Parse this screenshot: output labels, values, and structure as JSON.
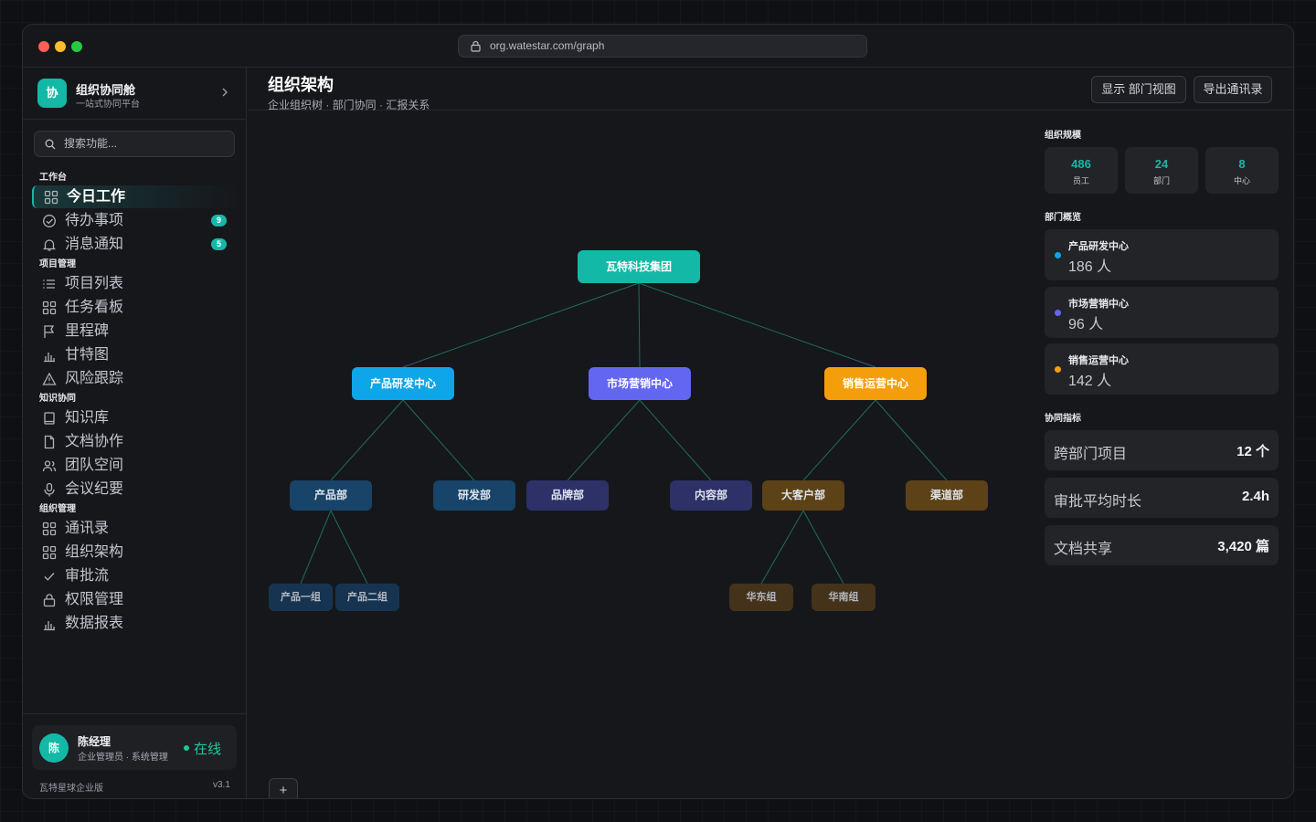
{
  "browser": {
    "url": "org.watestar.com/graph"
  },
  "brand": {
    "name": "组织协同舱",
    "subtitle": "一站式协同平台",
    "logo_text": "协"
  },
  "search": {
    "placeholder": "搜索功能..."
  },
  "sidebar": {
    "sections": [
      {
        "title": "工作台",
        "items": [
          {
            "label": "今日工作",
            "icon": "grid-icon",
            "active": true
          },
          {
            "label": "待办事项",
            "icon": "check-circle-icon",
            "badge": "9"
          },
          {
            "label": "消息通知",
            "icon": "bell-icon",
            "badge": "5"
          }
        ]
      },
      {
        "title": "项目管理",
        "items": [
          {
            "label": "项目列表",
            "icon": "list-icon"
          },
          {
            "label": "任务看板",
            "icon": "grid-icon"
          },
          {
            "label": "里程碑",
            "icon": "flag-icon"
          },
          {
            "label": "甘特图",
            "icon": "bar-chart-icon"
          },
          {
            "label": "风险跟踪",
            "icon": "warning-icon"
          }
        ]
      },
      {
        "title": "知识协同",
        "items": [
          {
            "label": "知识库",
            "icon": "book-icon"
          },
          {
            "label": "文档协作",
            "icon": "file-icon"
          },
          {
            "label": "团队空间",
            "icon": "users-icon"
          },
          {
            "label": "会议纪要",
            "icon": "mic-icon"
          }
        ]
      },
      {
        "title": "组织管理",
        "items": [
          {
            "label": "通讯录",
            "icon": "grid-icon"
          },
          {
            "label": "组织架构",
            "icon": "grid-icon"
          },
          {
            "label": "审批流",
            "icon": "check-icon"
          },
          {
            "label": "权限管理",
            "icon": "lock-icon"
          },
          {
            "label": "数据报表",
            "icon": "bar-chart-icon"
          }
        ]
      }
    ]
  },
  "user": {
    "avatar": "陈",
    "name": "陈经理",
    "role": "企业管理员 · 系统管理",
    "status": "在线"
  },
  "footer": {
    "edition": "瓦特星球企业版",
    "version": "v3.1"
  },
  "header": {
    "title": "组织架构",
    "subtitle": "企业组织树 · 部门协同 · 汇报关系",
    "btn_view": "显示 部门视图",
    "btn_export": "导出通讯录"
  },
  "org": {
    "root": "瓦特科技集团",
    "centers": [
      "产品研发中心",
      "市场营销中心",
      "销售运营中心"
    ],
    "departments": [
      "产品部",
      "研发部",
      "品牌部",
      "内容部",
      "大客户部",
      "渠道部"
    ],
    "groups": [
      "产品一组",
      "产品二组",
      "华东组",
      "华南组"
    ]
  },
  "canvas": {
    "add_label": "+"
  },
  "right": {
    "scale_title": "组织规模",
    "stats": [
      {
        "value": "486",
        "label": "员工"
      },
      {
        "value": "24",
        "label": "部门"
      },
      {
        "value": "8",
        "label": "中心"
      }
    ],
    "dept_title": "部门概览",
    "depts": [
      {
        "name": "产品研发中心",
        "count": "186 人",
        "color": "#0ea5e9"
      },
      {
        "name": "市场营销中心",
        "count": "96 人",
        "color": "#6366f1"
      },
      {
        "name": "销售运营中心",
        "count": "142 人",
        "color": "#f59e0b"
      }
    ],
    "metrics_title": "协同指标",
    "metrics": [
      {
        "key": "跨部门项目",
        "value": "12 个"
      },
      {
        "key": "审批平均时长",
        "value": "2.4h"
      },
      {
        "key": "文档共享",
        "value": "3,420 篇"
      }
    ]
  },
  "colors": {
    "accent": "#14b8a6",
    "center_product": "#0ea5e9",
    "center_marketing": "#6366f1",
    "center_sales": "#f59e0b"
  }
}
